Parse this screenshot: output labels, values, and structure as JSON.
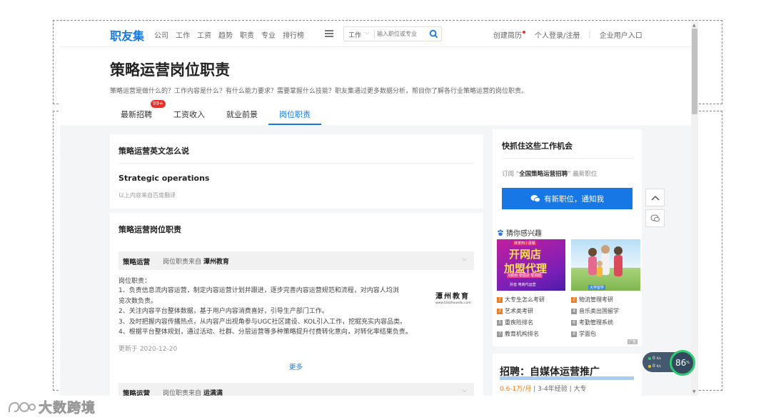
{
  "header": {
    "logo": "职友集",
    "nav": [
      "公司",
      "工作",
      "工资",
      "趋势",
      "职责",
      "专业",
      "排行榜"
    ],
    "search": {
      "type_label": "工作",
      "placeholder": "输入职位或专业"
    },
    "create_resume": "创建简历",
    "login": "个人登录/注册",
    "separator": "|",
    "enterprise": "企业用户入口"
  },
  "title_band": {
    "title": "策略运营岗位职责",
    "description": "策略运营是做什么的？工作内容是什么？有什么能力要求？需要掌握什么技能？职友集通过更多数据分析，帮目你了解各行业策略运营的岗位职责。",
    "tabs": [
      {
        "label": "最新招聘",
        "badge": "99+"
      },
      {
        "label": "工资收入"
      },
      {
        "label": "就业前景"
      },
      {
        "label": "岗位职责"
      }
    ]
  },
  "translation_card": {
    "title": "策略运营英文怎么说",
    "english": "Strategic operations",
    "source": "以上内容来自百度翻译"
  },
  "duties_card": {
    "title": "策略运营岗位职责",
    "entries": [
      {
        "role": "策略运营",
        "src_prefix": "岗位职责来自",
        "company": "潭州教育"
      },
      {
        "role": "策略运营",
        "src_prefix": "岗位职责来自",
        "company": "运满满"
      }
    ],
    "duty_head": "岗位职责：",
    "duties": [
      "1、负责信息流内容运营，制定内容运营计划并跟进，逐步完善内容运营规范和流程，对内容人均浏",
      "览次数负责。",
      "2、关注内容平台整体数据，基于用户内容消费喜好，引导生产部门工作。",
      "3、及时把握内容传播热点，从内容产出视角参与UGC社区建设、KOL引入工作，挖掘充实内容品类。",
      "4、根据平台整体规划，通过活动、社群、分层运营等多种策略提升付费转化意向，对转化率结果负责。"
    ],
    "stamp_name": "潭州教育",
    "stamp_url": "www.tanzhouedu.com",
    "updated": "更新于 2020-12-20",
    "more": "更多"
  },
  "subscribe_card": {
    "title": "快抓住这些工作机会",
    "text_prefix": "订阅 “",
    "text_bold": "全国策略运营招聘",
    "text_suffix": "” 最新职位",
    "button": "有新职位，通知我"
  },
  "interest_card": {
    "heading": "猜你感兴趣",
    "promo1": {
      "top": "抹茶田小嘉甄",
      "line1": "开网店",
      "line2": "加盟代理",
      "tag": "0费用 零囤货 零风险",
      "foot": "抖音 电商代运营"
    },
    "promo2_tag": "大学留学",
    "items": [
      {
        "num": "1",
        "label": "大专生怎么考研",
        "hot": true
      },
      {
        "num": "2",
        "label": "物流管理考研",
        "hot": true
      },
      {
        "num": "3",
        "label": "艺术类考研",
        "hot": true
      },
      {
        "num": "4",
        "label": "音乐类出国留学",
        "hot": false
      },
      {
        "num": "5",
        "label": "重疾险排名",
        "hot": false
      },
      {
        "num": "6",
        "label": "考勤管理系统",
        "hot": false
      },
      {
        "num": "7",
        "label": "教育机构排名",
        "hot": false
      },
      {
        "num": "8",
        "label": "学面包",
        "hot": false
      }
    ],
    "ad_tag": "广告"
  },
  "job_ad": {
    "title": "招聘：自媒体运营推广",
    "salary": "0.6-1万/月",
    "meta": "| 3-4年经验 | 大专"
  },
  "monitor": {
    "up": "0",
    "up_unit": "K/s",
    "down": "0",
    "down_unit": "K/s",
    "percent": "86",
    "percent_unit": "%"
  },
  "watermark": {
    "text": "大数跨境"
  },
  "colors": {
    "brand": "#1677e5",
    "badge": "#e5322d",
    "hot": "#f07c1e"
  }
}
